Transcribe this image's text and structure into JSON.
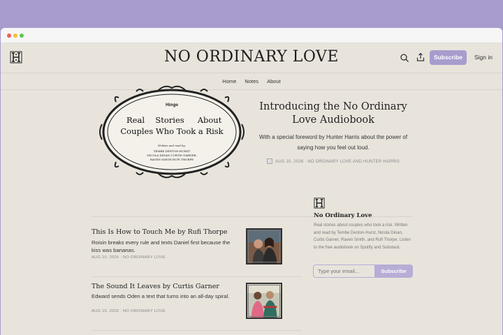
{
  "site": {
    "title": "NO ORDINARY LOVE",
    "logo_icon": "h-monogram-icon",
    "subscribe_label": "Subscribe",
    "signin_label": "Sign in"
  },
  "nav": {
    "items": [
      "Home",
      "Notes",
      "About"
    ]
  },
  "hero": {
    "art": {
      "brand": "Hinge",
      "line1": [
        "Real",
        "Stories",
        "About"
      ],
      "line2": "Couples Who Took a Risk",
      "credit_heading": "Written and read by:",
      "credit_rows": [
        "TEMBE DENTON-HURST",
        "NICOLA DINAN   CURTIS GARNER,",
        "RAVEN SMITH   RUFI THORPE"
      ]
    },
    "title": "Introducing the No Ordinary Love Audiobook",
    "subtitle": "With a special foreword by Hunter Harris about the power of saying how you feel out loud.",
    "meta": "AUG 10, 2026 · NO ORDINARY LOVE AND HUNTER HARRIS"
  },
  "posts": [
    {
      "title": "This Is How to Touch Me by Rufi Thorpe",
      "subtitle": "Roisin breaks every rule and texts Daniel first because the kiss was bananas.",
      "meta": "AUG 10, 2026 · NO ORDINARY LOVE"
    },
    {
      "title": "The Sound It Leaves by Curtis Garner",
      "subtitle": "Edward sends Oden a text that turns into an all-day spiral.",
      "meta": "AUG 10, 2026 · NO ORDINARY LOVE"
    }
  ],
  "sidebar": {
    "title": "No Ordinary Love",
    "description": "Real stories about couples who took a risk. Written and read by Tembe Denton-Hurst, Nicola Dinan, Curtis Garner, Raven Smith, and Rufi Thorpe. Listen to the free audiobook on Spotify and Substack.",
    "email_placeholder": "Type your email...",
    "subscribe_label": "Subscribe"
  },
  "colors": {
    "background": "#e8e4dc",
    "accent": "#a89ccd",
    "page_frame": "#a89ccd"
  }
}
